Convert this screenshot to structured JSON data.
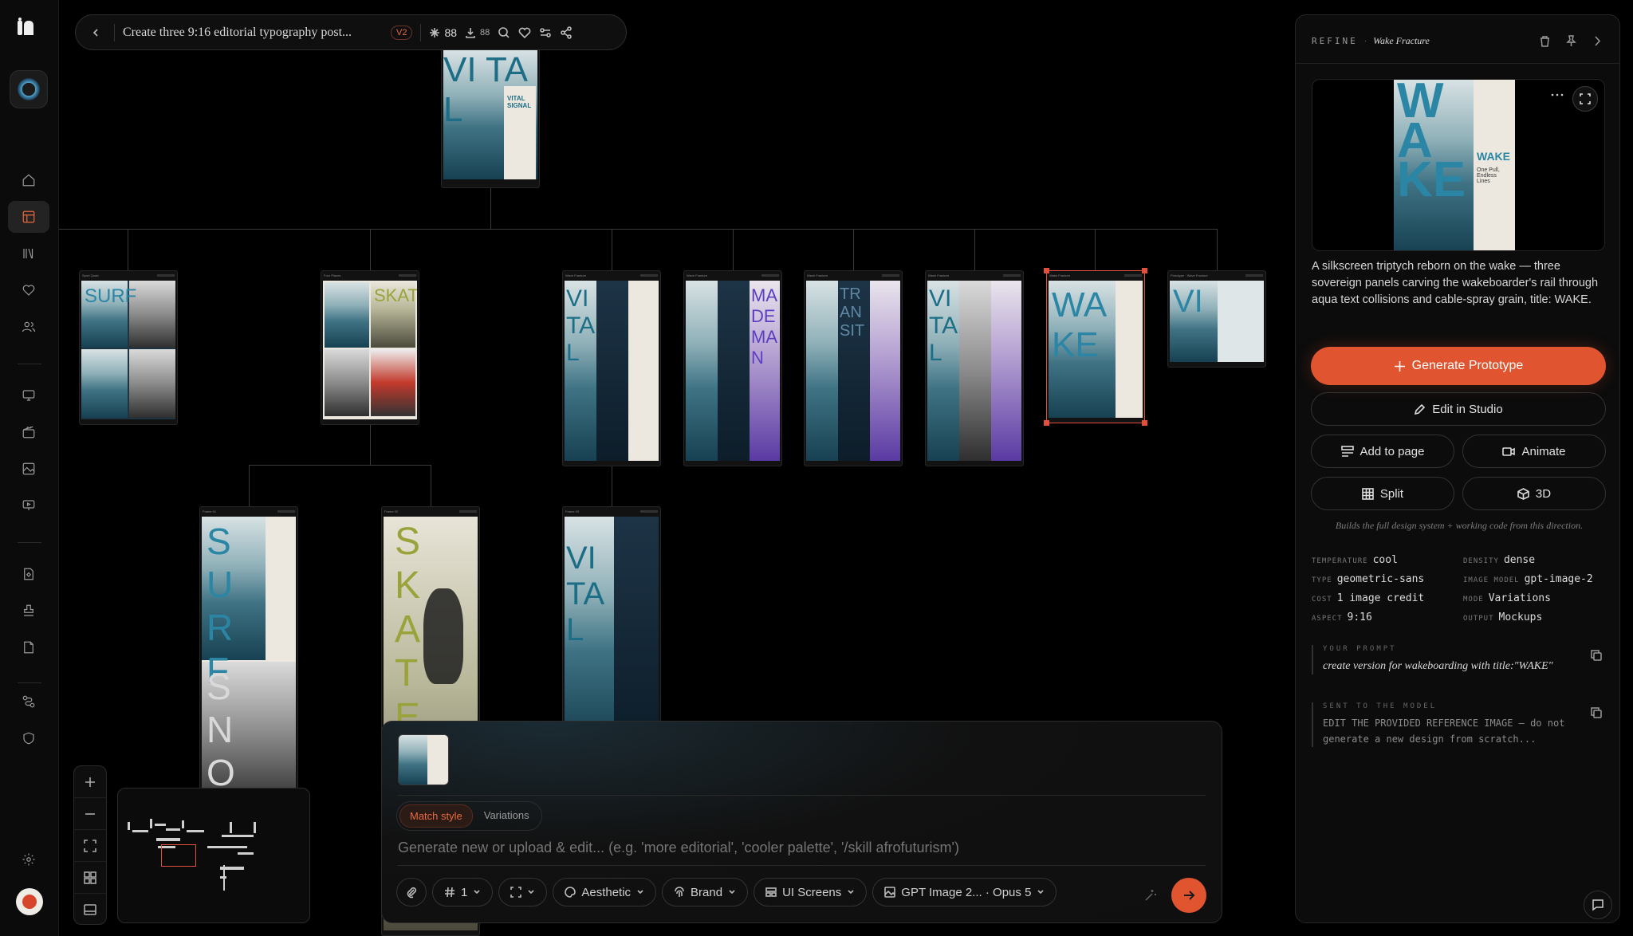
{
  "topbar": {
    "title": "Create three 9:16 editorial typography post...",
    "version": "V2",
    "likes": "88",
    "downloads": "88"
  },
  "canvas": {
    "root_poster": {
      "headline": "VI TA L",
      "subtitle": "VITAL SIGNAL"
    },
    "nodes": [
      {
        "label": "Sport Quad",
        "headline": "SURF"
      },
      {
        "label": "Four Places",
        "headline": "SKATE"
      },
      {
        "label": "Wave Fracture",
        "headline": "VITAL"
      },
      {
        "label": "Wave Fracture",
        "headline": "MADE MAN"
      },
      {
        "label": "Wave Fracture",
        "headline": "TRANSIT"
      },
      {
        "label": "Wave Fracture",
        "headline": "VITAL"
      },
      {
        "label": "Wake Fracture",
        "headline": "WAKE"
      },
      {
        "label": "Prototype · Wave Fracture",
        "headline": "VI"
      }
    ],
    "children": [
      {
        "label": "Frame 01",
        "headline": "SURF",
        "headline2": "SNOW"
      },
      {
        "label": "Frame 02",
        "headline": "SKATE"
      },
      {
        "label": "Frame 03",
        "headline": "VITAL"
      }
    ]
  },
  "composer": {
    "tabs": [
      "Match style",
      "Variations"
    ],
    "active_tab": "Match style",
    "placeholder": "Generate new or upload & edit... (e.g. 'more editorial', 'cooler palette', '/skill afrofuturism')",
    "count": "1",
    "aesthetic": "Aesthetic",
    "brand": "Brand",
    "ui_screens": "UI Screens",
    "model": "GPT Image 2... · Opus 5"
  },
  "panel": {
    "label": "REFINE",
    "name": "Wake Fracture",
    "preview_headline": "WA KE",
    "preview_sub": "WAKE",
    "preview_tagline": "One Pull, Endless Lines",
    "description": "A silkscreen triptych reborn on the wake — three sovereign panels carving the wakeboarder's rail through aqua text collisions and cable-spray grain, title: WAKE.",
    "generate": "Generate Prototype",
    "edit": "Edit in Studio",
    "add_to_page": "Add to page",
    "animate": "Animate",
    "split": "Split",
    "three_d": "3D",
    "note": "Builds the full design system + working code from this direction.",
    "meta": [
      {
        "k": "Temperature",
        "v": "cool"
      },
      {
        "k": "Density",
        "v": "dense"
      },
      {
        "k": "Type",
        "v": "geometric-sans"
      },
      {
        "k": "Image model",
        "v": "gpt-image-2"
      },
      {
        "k": "Cost",
        "v": "1 image credit"
      },
      {
        "k": "Mode",
        "v": "Variations"
      },
      {
        "k": "Aspect",
        "v": "9:16"
      },
      {
        "k": "Output",
        "v": "Mockups"
      }
    ],
    "your_prompt_label": "YOUR PROMPT",
    "your_prompt": "create version for wakeboarding with title:\"WAKE\"",
    "sent_label": "SENT TO THE MODEL",
    "sent": "EDIT THE PROVIDED REFERENCE IMAGE — do not generate a new design from scratch..."
  }
}
